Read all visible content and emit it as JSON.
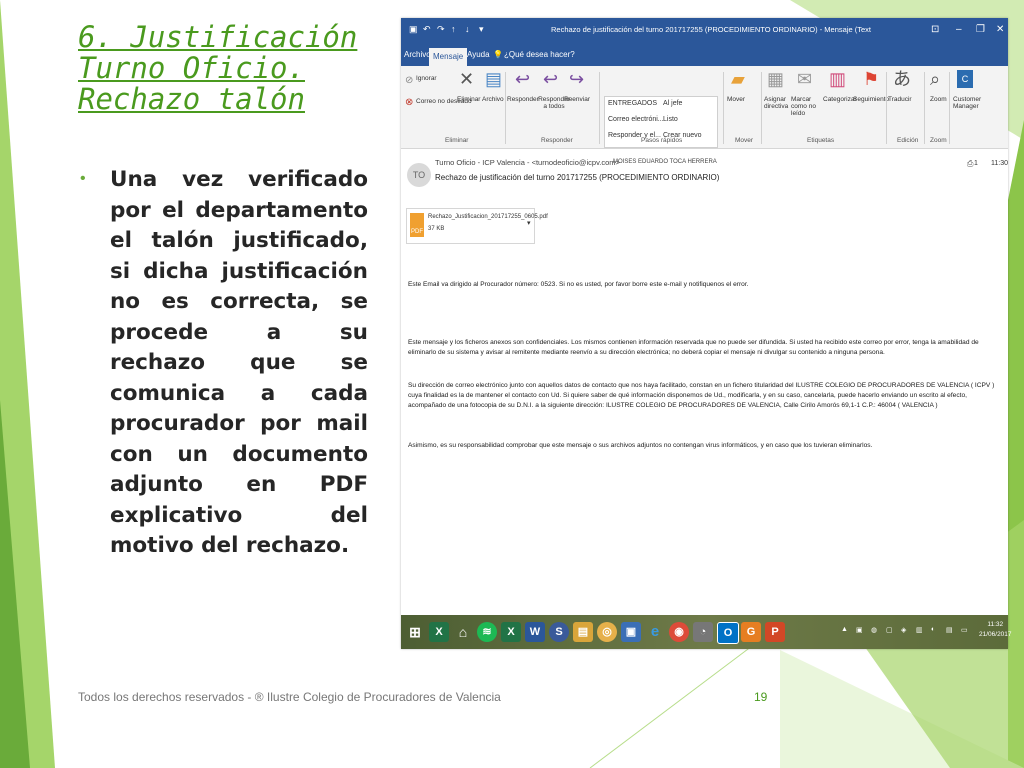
{
  "slide": {
    "title": "6. Justificación Turno Oficio. Rechazo talón",
    "bullet": "Una vez verificado por el departamento el talón justificado, si dicha justificación no es correcta, se procede a su rechazo que se comunica a cada procurador por mail con un documento adjunto en PDF explicativo del motivo del rechazo.",
    "footer": "Todos los derechos reservados - ® Ilustre Colegio de Procuradores de Valencia",
    "page_number": "19",
    "colors": {
      "accent_green": "#6aab3a",
      "title_green": "#4a9a1e"
    }
  },
  "outlook": {
    "window_title": "Rechazo de justificación del turno 201717255 (PROCEDIMIENTO ORDINARIO) - Mensaje (Texto sin formato)",
    "tabs": [
      {
        "label": "Archivo"
      },
      {
        "label": "Mensaje"
      },
      {
        "label": "Ayuda"
      },
      {
        "label": "¿Qué desea hacer?"
      }
    ],
    "ribbon": {
      "ignorar": "Ignorar",
      "correo_no_deseado": "Correo no deseado",
      "eliminar": "Eliminar",
      "archivo": "Archivo",
      "responder": "Responder",
      "responder_a_todos": "Responder a todos",
      "reenviar": "Reenviar",
      "quick_steps": [
        "ENTREGADOS",
        "Correo electróni...",
        "Responder y el...",
        "Al jefe",
        "Listo",
        "Crear nuevo"
      ],
      "mover": "Mover",
      "asignar_directiva": "Asignar directiva",
      "marcar_no_leido": "Marcar como no leído",
      "categorizar": "Categorizar",
      "seguimiento": "Seguimiento",
      "traducir": "Traducir",
      "zoom": "Zoom",
      "customer_manager": "Customer Manager",
      "groups": {
        "eliminar": "Eliminar",
        "responder": "Responder",
        "pasos_rapidos": "Pasos rápidos",
        "mover": "Mover",
        "etiquetas": "Etiquetas",
        "edicion": "Edición",
        "zoom": "Zoom"
      }
    },
    "message": {
      "avatar_initials": "TO",
      "from": "Turno Oficio - ICP Valencia - <turnodeoficio@icpv.com>",
      "to": "MOISES EDUARDO TOCA HERRERA",
      "subject": "Rechazo de justificación del turno 201717255 (PROCEDIMIENTO ORDINARIO)",
      "time": "11:30",
      "attachment_count": "1",
      "attachment_name": "Rechazo_Justificacion_201717255_0605.pdf",
      "attachment_size": "37 KB",
      "pdf_label": "PDF",
      "body": [
        "Este Email va dirigido al Procurador número: 0523. Si no es usted, por favor borre este e-mail y notifiquenos el error.",
        "Este mensaje y los ficheros anexos son confidenciales. Los mismos contienen información reservada que no puede ser difundida. Si usted ha recibido este correo por error, tenga la amabilidad de eliminarlo de su sistema y avisar al remitente mediante reenvío a su dirección electrónica; no deberá copiar el mensaje ni divulgar su contenido a ninguna persona.",
        "Su dirección de correo electrónico junto con aquellos datos de contacto que nos haya facilitado, constan en un fichero titularidad del ILUSTRE COLEGIO DE PROCURADORES DE VALENCIA ( ICPV ) cuya finalidad es la de mantener el contacto con Ud. Si quiere saber de qué información disponemos de Ud., modificarla, y en su caso, cancelarla, puede hacerlo enviando un escrito al efecto, acompañado de una fotocopia de su D.N.I. a la siguiente dirección: ILUSTRE COLEGIO DE PROCURADORES DE VALENCIA, Calle Cirilo Amorós 69,1-1 C.P.: 46004 ( VALENCIA )",
        "Asimismo, es su responsabilidad comprobar que este mensaje o sus archivos adjuntos no contengan virus informáticos, y en caso que los tuvieran eliminarlos."
      ]
    },
    "taskbar": {
      "clock_time": "11:32",
      "clock_date": "21/06/2017"
    }
  }
}
